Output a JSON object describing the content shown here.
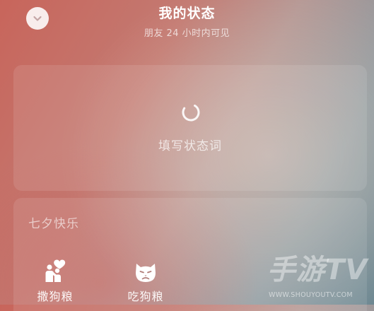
{
  "header": {
    "title": "我的状态",
    "subtitle": "朋友 24 小时内可见",
    "back_icon": "chevron-down-icon"
  },
  "status_input": {
    "placeholder": "填写状态词",
    "loading_icon": "spinner-icon"
  },
  "category": {
    "title": "七夕快乐",
    "items": [
      {
        "label": "撒狗粮",
        "icon": "couple-heart-icon"
      },
      {
        "label": "吃狗粮",
        "icon": "grumpy-cat-icon"
      }
    ]
  },
  "watermark": {
    "main": "手游TV",
    "url": "WWW.SHOUYOUTV.COM"
  },
  "colors": {
    "bg_left": "#c8655b",
    "bg_right": "#6c8791",
    "text": "#ffffff"
  }
}
